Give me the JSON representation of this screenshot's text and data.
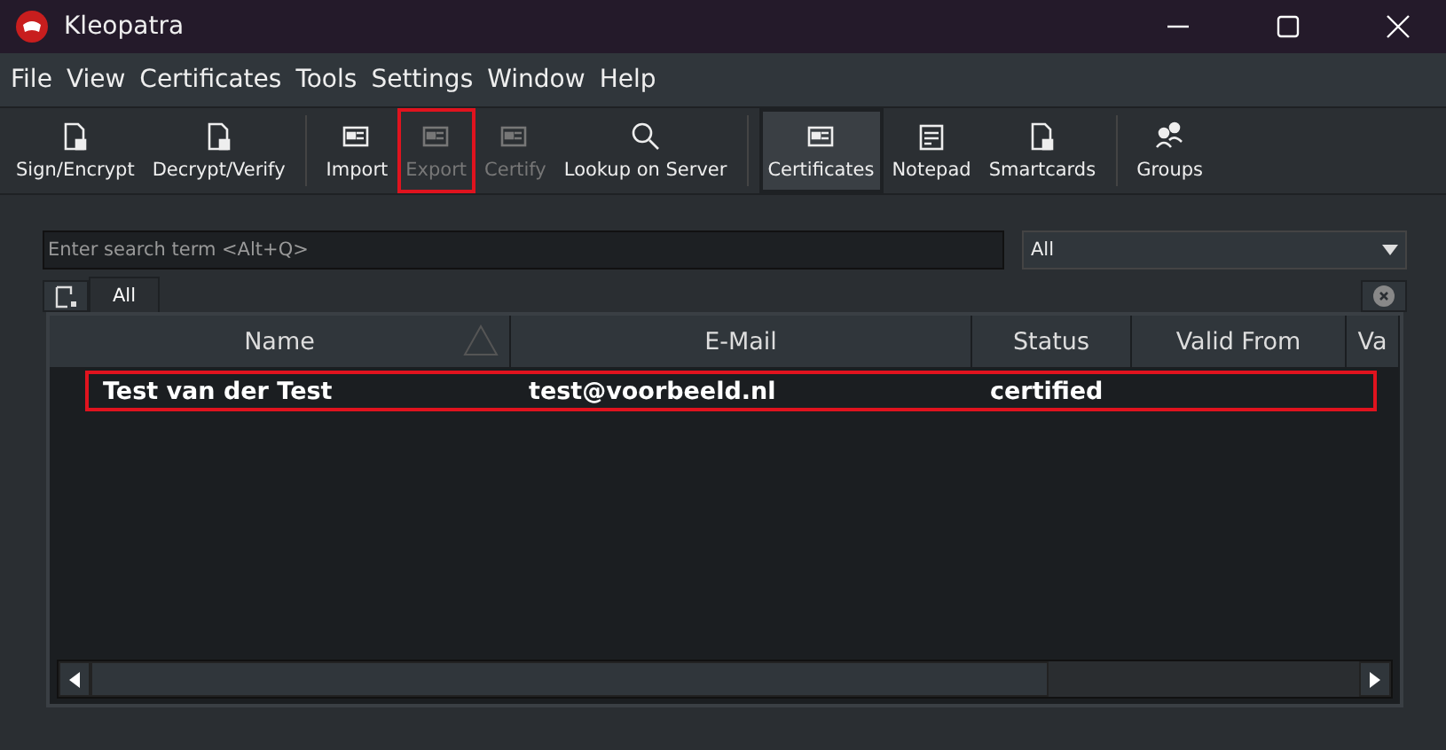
{
  "window": {
    "title": "Kleopatra"
  },
  "menu": [
    "File",
    "View",
    "Certificates",
    "Tools",
    "Settings",
    "Window",
    "Help"
  ],
  "toolbar": {
    "groups": [
      [
        {
          "label": "Sign/Encrypt",
          "disabled": false,
          "selected": false,
          "highlighted": false
        },
        {
          "label": "Decrypt/Verify",
          "disabled": false,
          "selected": false,
          "highlighted": false
        }
      ],
      [
        {
          "label": "Import",
          "disabled": false,
          "selected": false,
          "highlighted": false
        },
        {
          "label": "Export",
          "disabled": true,
          "selected": false,
          "highlighted": true
        },
        {
          "label": "Certify",
          "disabled": true,
          "selected": false,
          "highlighted": false
        },
        {
          "label": "Lookup on Server",
          "disabled": false,
          "selected": false,
          "highlighted": false
        }
      ],
      [
        {
          "label": "Certificates",
          "disabled": false,
          "selected": true,
          "highlighted": false
        },
        {
          "label": "Notepad",
          "disabled": false,
          "selected": false,
          "highlighted": false
        },
        {
          "label": "Smartcards",
          "disabled": false,
          "selected": false,
          "highlighted": false
        }
      ],
      [
        {
          "label": "Groups",
          "disabled": false,
          "selected": false,
          "highlighted": false
        }
      ]
    ]
  },
  "search": {
    "placeholder": "Enter search term <Alt+Q>"
  },
  "filter": {
    "value": "All"
  },
  "tabs": [
    {
      "label": "All",
      "selected": true
    }
  ],
  "table": {
    "columns": [
      "Name",
      "E-Mail",
      "Status",
      "Valid From",
      "Va"
    ],
    "rows": [
      {
        "cells": [
          "Test van der Test",
          "test@voorbeeld.nl",
          "certified"
        ],
        "highlighted": true
      }
    ]
  }
}
